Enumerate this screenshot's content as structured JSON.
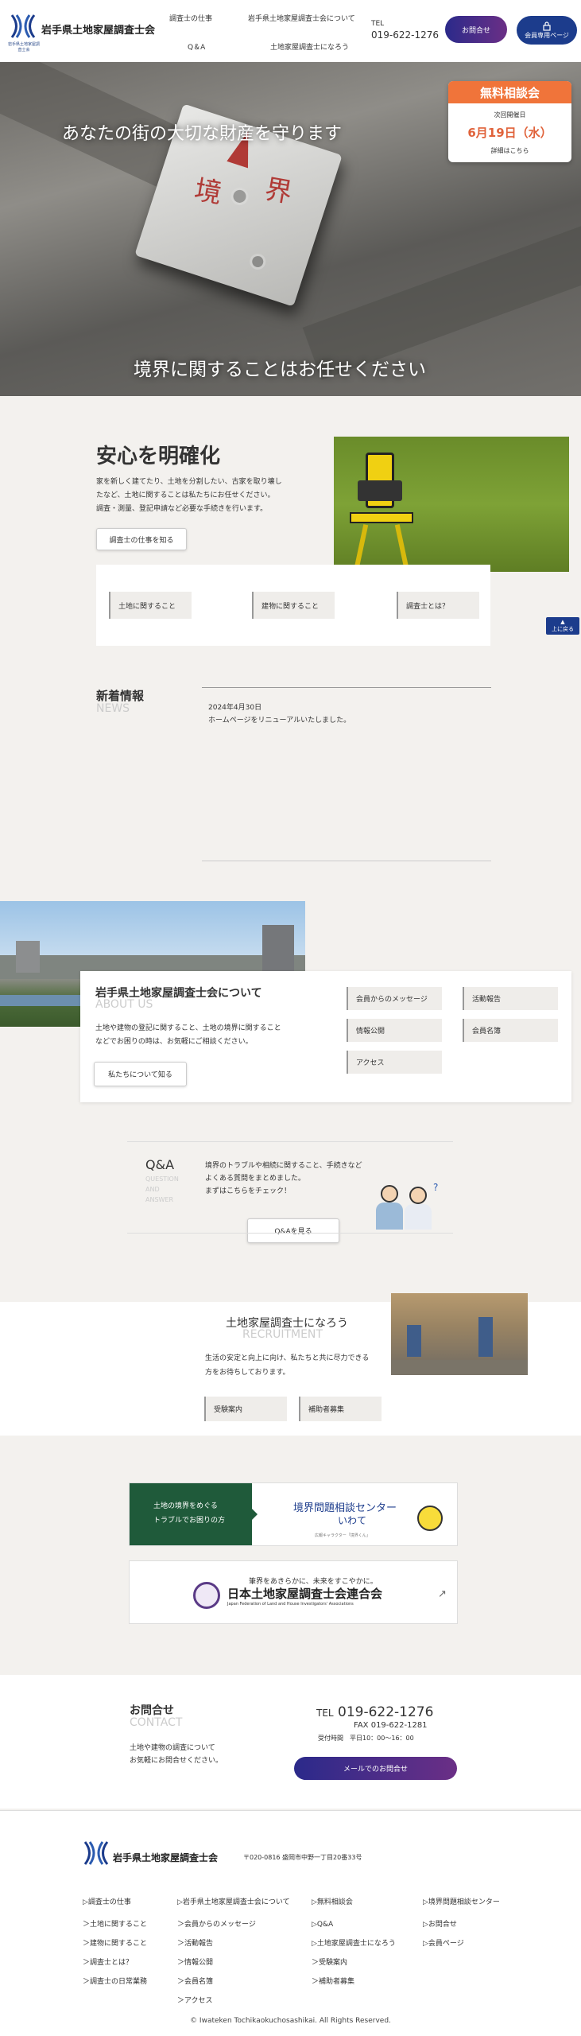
{
  "header": {
    "logo_sub": "岩手県土地家屋調査士会",
    "title": "岩手県土地家屋調査士会",
    "nav": [
      "調査士の仕事",
      "岩手県土地家屋調査士会について",
      "Q＆A",
      "土地家屋調査士になろう"
    ],
    "tel_label": "TEL",
    "tel": "019-622-1276",
    "contact_label": "お問合せ",
    "member_label": "会員専用ページ"
  },
  "hero": {
    "tagline": "あなたの街の大切な財産を守ります",
    "tagline2": "境界に関することはお任せください",
    "plate_chars": [
      "境",
      "界"
    ]
  },
  "consult": {
    "title": "無料相談会",
    "next_label": "次回開催日",
    "date": "6月19日（水）",
    "detail": "詳細はこちら"
  },
  "clarify": {
    "title": "安心を明確化",
    "text": [
      "家を新しく建てたり、土地を分割したい、古家を取り壊し",
      "たなど、土地に関することは私たちにお任せください。",
      "調査・測量、登記申請など必要な手続きを行います。"
    ],
    "button": "調査士の仕事を知る",
    "tags": [
      "土地に関すること",
      "建物に関すること",
      "調査士とは？"
    ]
  },
  "to_top": "上に戻る",
  "news": {
    "title": "新着情報",
    "en": "NEWS",
    "date": "2024年4月30日",
    "text": "ホームページをリニューアルいたしました。"
  },
  "about": {
    "title": "岩手県土地家屋調査士会について",
    "en": "ABOUT US",
    "text": [
      "土地や建物の登記に関すること、土地の境界に関すること",
      "などでお困りの時は、お気軽にご相談ください。"
    ],
    "button": "私たちについて知る",
    "links": [
      "会員からのメッセージ",
      "活動報告",
      "情報公開",
      "会員名簿",
      "アクセス"
    ]
  },
  "qa": {
    "title": "Q&A",
    "en": [
      "QUESTION",
      "AND",
      "ANSWER"
    ],
    "text": [
      "境界のトラブルや相続に関すること、手続きなど",
      "よくある質問をまとめました。",
      "まずはこちらをチェック！"
    ],
    "button": "Q&Aを見る"
  },
  "recruit": {
    "title": "土地家屋調査士になろう",
    "en": "RECRUITMENT",
    "text": [
      "生活の安定と向上に向け、私たちと共に尽力できる",
      "方をお待ちしております。"
    ],
    "tags": [
      "受験案内",
      "補助者募集"
    ]
  },
  "banner1": {
    "left1": "土地の境界をめぐる",
    "left2": "トラブルでお困りの方",
    "title": "境界問題相談センター",
    "sub": "いわて",
    "caption": "広報キャラクター「境界くん」"
  },
  "banner2": {
    "tagline": "筆界をあきらかに、未来をすこやかに。",
    "title": "日本土地家屋調査士会連合会",
    "en": "Japan Federation of Land and House Investigators' Associations"
  },
  "contact": {
    "title": "お問合せ",
    "en": "CONTACT",
    "text": [
      "土地や建物の調査について",
      "お気軽にお問合せください。"
    ],
    "tel_prefix": "TEL",
    "tel": "019-622-1276",
    "fax": "FAX 019-622-1281",
    "hours": "受付時間　平日10：00〜16：00",
    "button": "メールでのお問合せ"
  },
  "footer": {
    "name": "岩手県土地家屋調査士会",
    "address": "〒020-0816 盛岡市中野一丁目20番33号",
    "col1": [
      "▷調査士の仕事",
      "＞土地に関すること",
      "＞建物に関すること",
      "＞調査士とは？",
      "＞調査士の日常業務"
    ],
    "col2": [
      "▷岩手県土地家屋調査士会について",
      "＞会員からのメッセージ",
      "＞活動報告",
      "＞情報公開",
      "＞会員名簿",
      "＞アクセス"
    ],
    "col3": [
      "▷無料相談会",
      "▷Q&A",
      "▷土地家屋調査士になろう",
      "＞受験案内",
      "＞補助者募集"
    ],
    "col4": [
      "▷境界問題相談センター",
      "▷お問合せ",
      "▷会員ページ"
    ],
    "copyright": "© Iwateken Tochikaokuchosashikai. All Rights Reserved."
  }
}
